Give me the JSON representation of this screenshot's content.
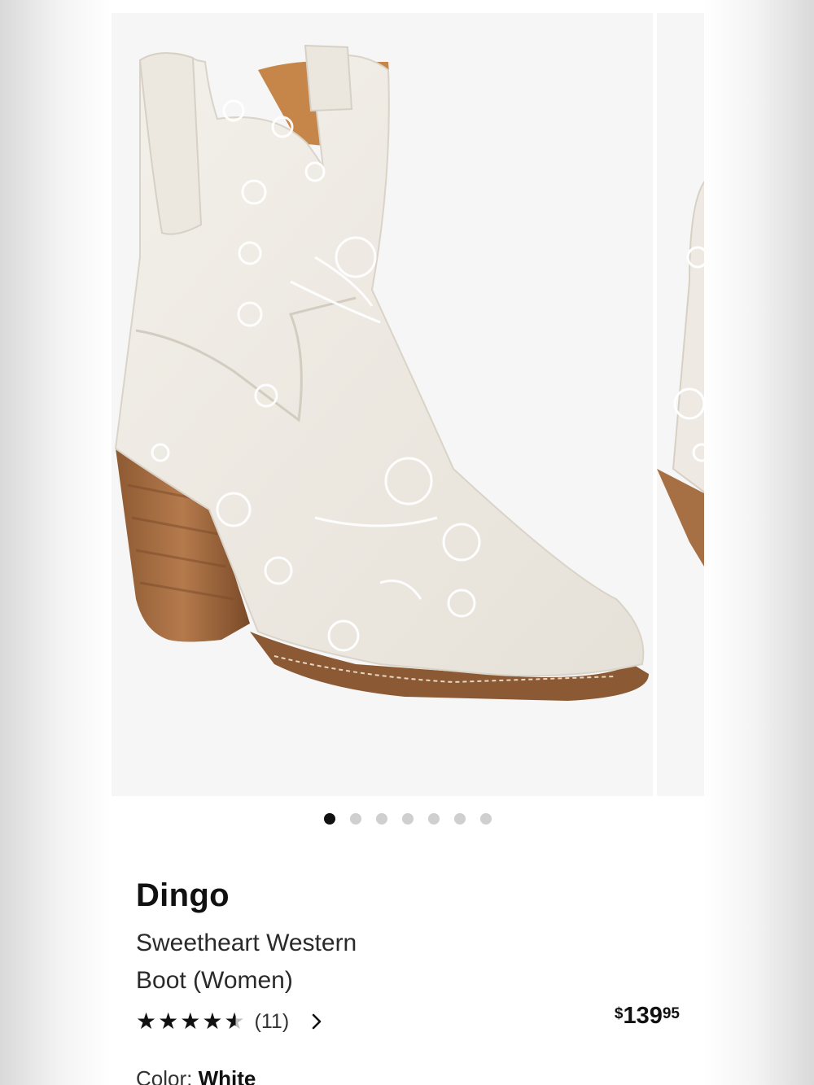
{
  "product": {
    "brand": "Dingo",
    "title_line1": "Sweetheart Western",
    "title_line2": "Boot (Women)",
    "rating": 4.5,
    "review_count": "(11)",
    "price_symbol": "$",
    "price_dollars": "139",
    "price_cents": "95",
    "color_label": "Color:",
    "color_value": "White"
  },
  "carousel": {
    "image_count": 7,
    "active_index": 0
  },
  "icons": {
    "rating_icon": "star-icon",
    "reviews_link_icon": "chevron-right-icon"
  },
  "colors": {
    "accent": "#111111",
    "dot_inactive": "#cfcfcf",
    "image_bg": "#f6f6f6"
  }
}
